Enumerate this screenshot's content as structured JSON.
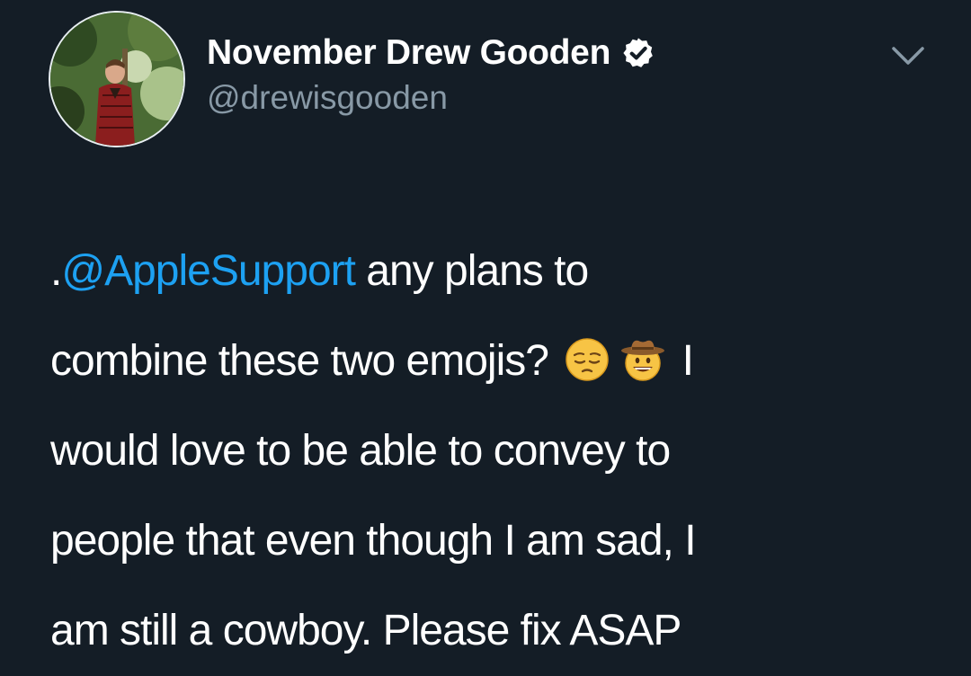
{
  "tweet": {
    "display_name": "November Drew Gooden",
    "handle": "@drewisgooden",
    "verified": true,
    "icons": {
      "verified": "verified-badge-icon",
      "menu": "chevron-down-icon",
      "emoji_1": "pensive-face-emoji",
      "emoji_2": "cowboy-hat-face-emoji"
    },
    "colors": {
      "background": "#141d26",
      "mention": "#1da1f2",
      "handle": "#8899a6",
      "text": "#ffffff"
    },
    "body": {
      "line1_prefix": ".",
      "mention": "@AppleSupport",
      "line1_suffix": " any plans to",
      "line2_text": "combine these two emojis?",
      "line2_after_emoji": "I",
      "line3": "would love to be able to convey to",
      "line4": "people that even though I am sad, I",
      "line5": "am still a cowboy. Please fix ASAP"
    }
  }
}
